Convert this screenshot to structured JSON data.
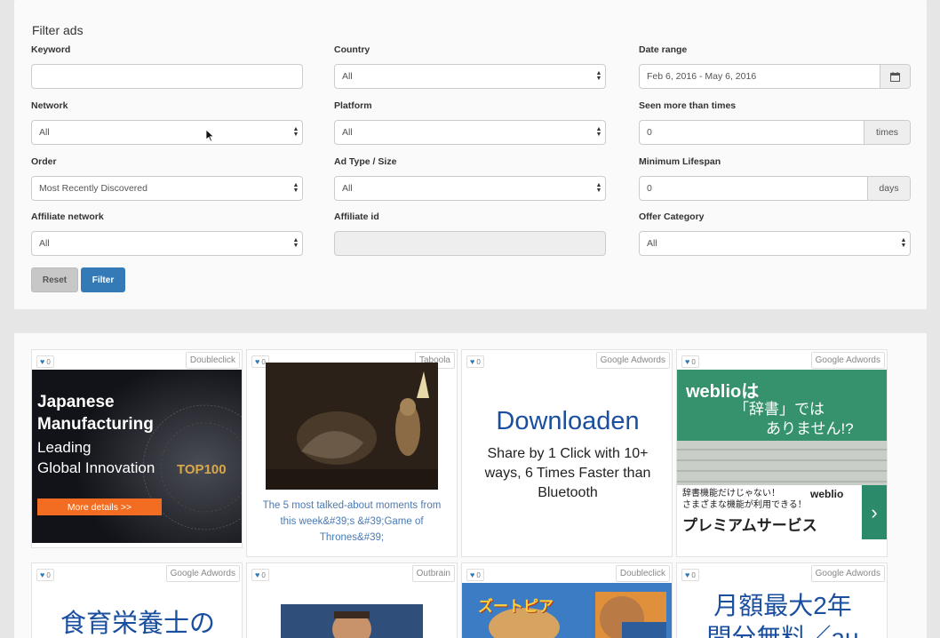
{
  "filter": {
    "title": "Filter ads",
    "keyword": {
      "label": "Keyword",
      "value": ""
    },
    "country": {
      "label": "Country",
      "value": "All"
    },
    "date_range": {
      "label": "Date range",
      "value": "Feb 6, 2016 - May 6, 2016"
    },
    "network": {
      "label": "Network",
      "value": "All"
    },
    "platform": {
      "label": "Platform",
      "value": "All"
    },
    "seen": {
      "label": "Seen more than times",
      "value": "0",
      "addon": "times"
    },
    "order": {
      "label": "Order",
      "value": "Most Recently Discovered"
    },
    "ad_type": {
      "label": "Ad Type / Size",
      "value": "All"
    },
    "lifespan": {
      "label": "Minimum Lifespan",
      "value": "0",
      "addon": "days"
    },
    "affiliate_network": {
      "label": "Affiliate network",
      "value": "All"
    },
    "affiliate_id": {
      "label": "Affiliate id",
      "value": ""
    },
    "offer_category": {
      "label": "Offer Category",
      "value": "All"
    },
    "reset_label": "Reset",
    "filter_label": "Filter"
  },
  "ads": [
    {
      "network": "Doubleclick",
      "likes": "0",
      "lines": [
        "Japanese",
        "Manufacturing",
        "Leading",
        "Global Innovation"
      ],
      "cta": "More details >>",
      "badge": "TOP100"
    },
    {
      "network": "Taboola",
      "likes": "0",
      "caption": "The 5 most talked-about moments from this week&#39;s &#39;Game of Thrones&#39;"
    },
    {
      "network": "Google Adwords",
      "likes": "0",
      "headline": "Downloaden",
      "body": "Share by 1 Click with 10+ ways, 6 Times Faster than Bluetooth"
    },
    {
      "network": "Google Adwords",
      "likes": "0",
      "line1": "weblioは",
      "line2": "「辞書」では",
      "line3": "ありません!?",
      "sub1": "辞書機能だけじゃない！",
      "sub2": "さまざまな機能が利用できる！",
      "brand": "weblio",
      "cta": "プレミアムサービス",
      "arrow": "›"
    },
    {
      "network": "Google Adwords",
      "likes": "0",
      "headline": "食育栄養士の"
    },
    {
      "network": "Outbrain",
      "likes": "0"
    },
    {
      "network": "Doubleclick",
      "likes": "0",
      "title": "ズートピア"
    },
    {
      "network": "Google Adwords",
      "likes": "0",
      "line1": "月額最大2年",
      "line2": "間分無料／au"
    }
  ],
  "colors": {
    "primary": "#337ab7",
    "link": "#4a7ab5",
    "ad_blue": "#1a4fa0",
    "weblio_green": "#2f8a64",
    "cta_orange": "#f26d21"
  }
}
